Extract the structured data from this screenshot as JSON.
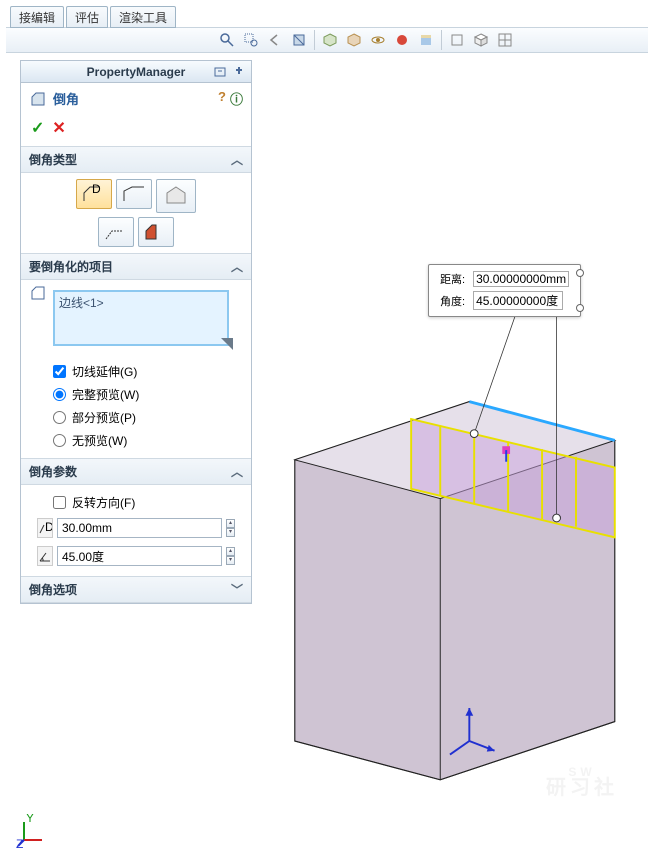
{
  "tabs": [
    "接编辑",
    "评估",
    "渲染工具"
  ],
  "pm_title": "PropertyManager",
  "feature": {
    "name": "倒角"
  },
  "sections": {
    "type": {
      "title": "倒角类型"
    },
    "items": {
      "title": "要倒角化的项目",
      "selection": "边线<1>",
      "tangent": "切线延伸(G)",
      "preview_full": "完整预览(W)",
      "preview_partial": "部分预览(P)",
      "preview_none": "无预览(W)"
    },
    "params": {
      "title": "倒角参数",
      "reverse": "反转方向(F)",
      "distance": "30.00mm",
      "angle": "45.00度"
    },
    "options": {
      "title": "倒角选项"
    }
  },
  "callout": {
    "dist_label": "距离:",
    "dist_value": "30.00000000mm",
    "ang_label": "角度:",
    "ang_value": "45.00000000度"
  },
  "watermark": {
    "l1": "SW",
    "l2": "研习社"
  }
}
